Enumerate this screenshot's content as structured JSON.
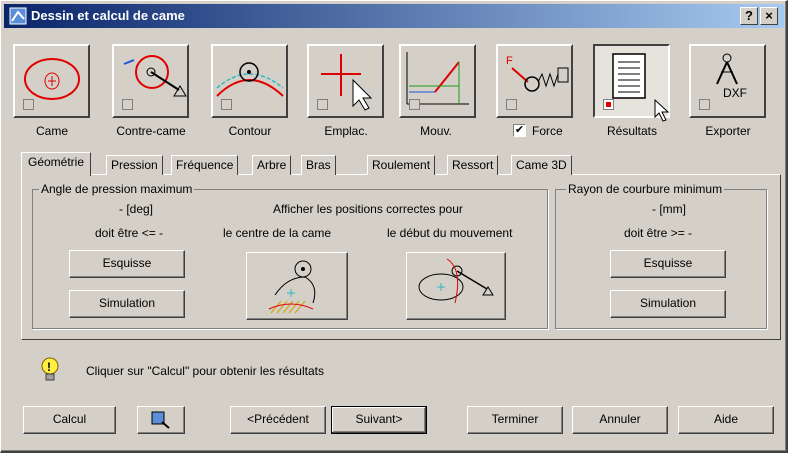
{
  "window": {
    "title": "Dessin et calcul de came",
    "help_glyph": "?",
    "close_glyph": "×"
  },
  "toolbar": [
    {
      "id": "came",
      "label": "Came",
      "checked": false
    },
    {
      "id": "contre_came",
      "label": "Contre-came",
      "checked": false
    },
    {
      "id": "contour",
      "label": "Contour",
      "checked": false
    },
    {
      "id": "emplac",
      "label": "Emplac.",
      "checked": false
    },
    {
      "id": "mouv",
      "label": "Mouv.",
      "checked": false
    },
    {
      "id": "force",
      "label": "Force",
      "checked": true
    },
    {
      "id": "resultats",
      "label": "Résultats",
      "checked": true
    },
    {
      "id": "exporter",
      "label": "Exporter",
      "checked": false,
      "icon_text": "DXF"
    }
  ],
  "tabs": [
    "Géométrie",
    "Pression",
    "Fréquence",
    "Arbre",
    "Bras",
    "Roulement",
    "Ressort",
    "Came 3D"
  ],
  "active_tab": "Géométrie",
  "pressure_group": {
    "title": "Angle de pression maximum",
    "value_line": "-   [deg]",
    "limit_line": "doit être <= -",
    "show_positions_label": "Afficher les positions correctes pour",
    "center_label": "le centre de la came",
    "start_label": "le début du mouvement",
    "sketch_button": "Esquisse",
    "simulation_button": "Simulation"
  },
  "curvature_group": {
    "title": "Rayon de courbure minimum",
    "value_line": "-   [mm]",
    "limit_line": "doit être  >= -",
    "sketch_button": "Esquisse",
    "simulation_button": "Simulation"
  },
  "hint": {
    "text": "Cliquer sur \"Calcul\" pour obtenir les résultats"
  },
  "footer": {
    "calc": "Calcul",
    "previous": "<Précédent",
    "next": "Suivant>",
    "finish": "Terminer",
    "cancel": "Annuler",
    "help": "Aide"
  },
  "colors": {
    "title_start": "#0a246a",
    "title_end": "#a6caf0",
    "face": "#d4d0c8",
    "accent_red": "#e00000"
  }
}
